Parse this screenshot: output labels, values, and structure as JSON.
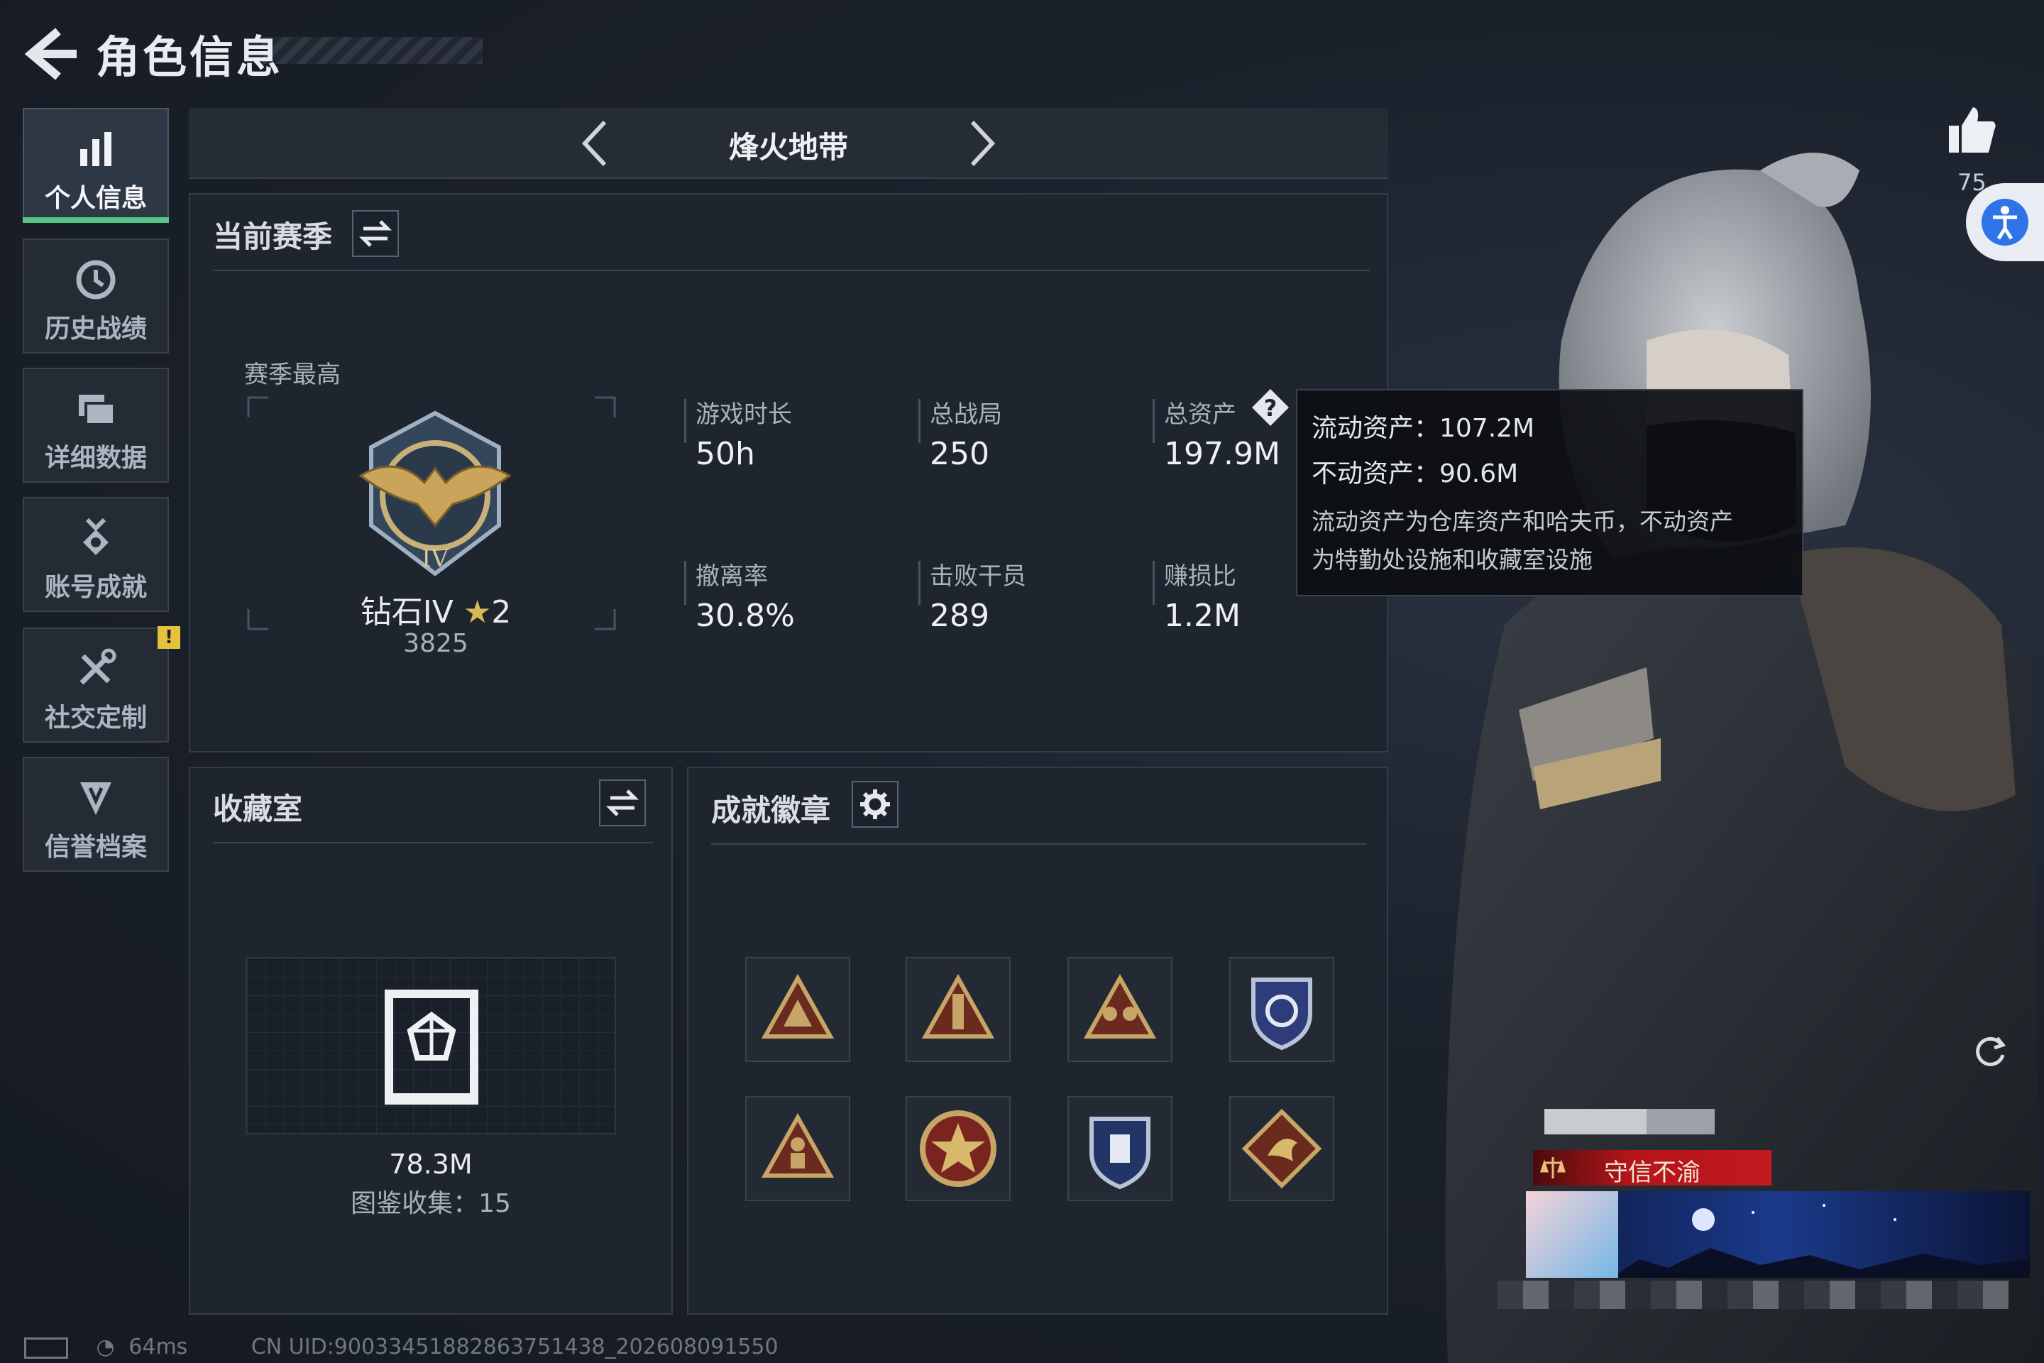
{
  "header": {
    "title": "角色信息"
  },
  "sidebar": {
    "items": [
      {
        "label": "个人信息",
        "icon": "bar-chart-icon"
      },
      {
        "label": "历史战绩",
        "icon": "clock-icon"
      },
      {
        "label": "详细数据",
        "icon": "folder-icon"
      },
      {
        "label": "账号成就",
        "icon": "medal-icon"
      },
      {
        "label": "社交定制",
        "icon": "tools-icon",
        "badge": "!"
      },
      {
        "label": "信誉档案",
        "icon": "shield-icon"
      }
    ]
  },
  "mode": {
    "title": "烽火地带"
  },
  "season": {
    "title": "当前赛季",
    "best_label": "赛季最高",
    "rank_name": "钻石IV",
    "rank_stars": "2",
    "rank_score": "3825",
    "stats": [
      {
        "label": "游戏时长",
        "value": "50h"
      },
      {
        "label": "总战局",
        "value": "250"
      },
      {
        "label": "总资产",
        "value": "197.9M"
      },
      {
        "label": "撤离率",
        "value": "30.8%"
      },
      {
        "label": "击败干员",
        "value": "289"
      },
      {
        "label": "赚损比",
        "value": "1.2M"
      }
    ]
  },
  "tooltip": {
    "liquid": "流动资产：107.2M",
    "fixed": "不动资产：90.6M",
    "note_line1": "流动资产为仓库资产和哈夫币，不动资产",
    "note_line2": "为特勤处设施和收藏室设施"
  },
  "collection": {
    "title": "收藏室",
    "value": "78.3M",
    "count_text": "图鉴收集：15"
  },
  "achievements": {
    "title": "成就徽章",
    "badges": [
      "triangle-gold-icon",
      "triangle-rocket-icon",
      "triangle-team-icon",
      "shield-blue-icon",
      "triangle-figure-icon",
      "star-wreath-icon",
      "shield-navy-icon",
      "dragon-diamond-icon"
    ]
  },
  "profile": {
    "likes": "75",
    "honor_title": "守信不渝"
  },
  "footer": {
    "ping": "64ms",
    "uid": "CN UID:9003345188286375143​8_202608091550"
  },
  "colors": {
    "accent_green": "#58c48a",
    "warning": "#e6c23b",
    "plate_red": "#c11a20",
    "a11y_blue": "#2e74e8"
  }
}
